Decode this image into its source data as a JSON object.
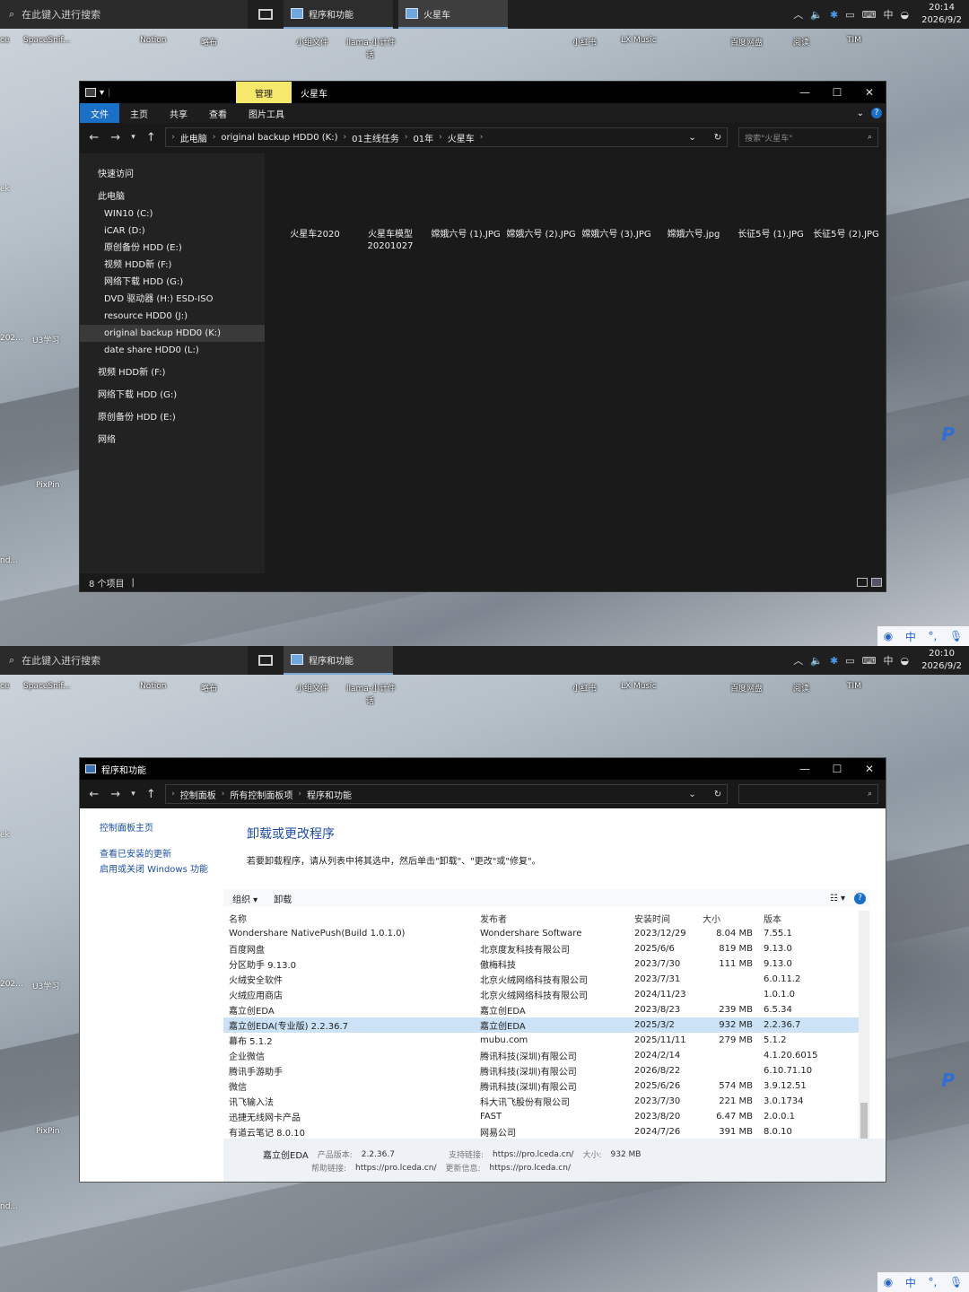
{
  "top": {
    "taskbar": {
      "search_placeholder": "在此键入进行搜索",
      "apps": [
        "程序和功能",
        "火星车"
      ],
      "time": "20:14",
      "date": "2026/9/2",
      "ime": "中"
    },
    "desktop_icons": [
      "ce",
      "SpaceSnif...",
      "Notion",
      "略布",
      "小组文件",
      "llama-小计件",
      "小红书",
      "LX Music",
      "百度网盘",
      "阅读",
      "TIM"
    ],
    "desktop_sub": "话",
    "side_labels": [
      "ek",
      "202...",
      "U3学习",
      "PixPin",
      "nd..."
    ],
    "explorer": {
      "title": "火星车",
      "manage_tab": "管理",
      "ribbon_tabs": [
        "文件",
        "主页",
        "共享",
        "查看",
        "图片工具"
      ],
      "breadcrumb": [
        "此电脑",
        "original backup HDD0 (K:)",
        "01主线任务",
        "01年",
        "火星车"
      ],
      "search_placeholder": "搜索\"火星车\"",
      "nav": {
        "quick": "快速访问",
        "pc": "此电脑",
        "drives": [
          "WIN10 (C:)",
          "iCAR (D:)",
          "原创备份 HDD (E:)",
          "视频 HDD新 (F:)",
          "网络下载 HDD (G:)",
          "DVD 驱动器 (H:) ESD-ISO",
          "resource HDD0 (J:)",
          "original backup HDD0 (K:)",
          "date share HDD0 (L:)"
        ],
        "extra": [
          "视频 HDD新 (F:)",
          "网络下载 HDD (G:)",
          "原创备份 HDD (E:)",
          "网络"
        ]
      },
      "files": [
        "火星车2020",
        "火星车模型 20201027",
        "嫦娥六号 (1).JPG",
        "嫦娥六号 (2).JPG",
        "嫦娥六号 (3).JPG",
        "嫦娥六号.jpg",
        "长征5号 (1).JPG",
        "长征5号 (2).JPG"
      ],
      "status": "8 个项目"
    }
  },
  "bottom": {
    "taskbar": {
      "search_placeholder": "在此键入进行搜索",
      "apps": [
        "程序和功能"
      ],
      "time": "20:10",
      "date": "2026/9/2",
      "ime": "中"
    },
    "window": {
      "title": "程序和功能",
      "breadcrumb": [
        "控制面板",
        "所有控制面板项",
        "程序和功能"
      ],
      "left_links": [
        "控制面板主页",
        "查看已安装的更新",
        "启用或关闭 Windows 功能"
      ],
      "heading": "卸载或更改程序",
      "description": "若要卸载程序，请从列表中将其选中，然后单击\"卸载\"、\"更改\"或\"修复\"。",
      "toolbar": [
        "组织 ▾",
        "卸载"
      ],
      "columns": [
        "名称",
        "发布者",
        "安装时间",
        "大小",
        "版本"
      ],
      "rows": [
        [
          "Wondershare NativePush(Build 1.0.1.0)",
          "Wondershare Software",
          "2023/12/29",
          "8.04 MB",
          "7.55.1"
        ],
        [
          "百度网盘",
          "北京度友科技有限公司",
          "2025/6/6",
          "819 MB",
          "9.13.0"
        ],
        [
          "分区助手 9.13.0",
          "傲梅科技",
          "2023/7/30",
          "111 MB",
          "9.13.0"
        ],
        [
          "火绒安全软件",
          "北京火绒网络科技有限公司",
          "2023/7/31",
          "",
          "6.0.11.2"
        ],
        [
          "火绒应用商店",
          "北京火绒网络科技有限公司",
          "2024/11/23",
          "",
          "1.0.1.0"
        ],
        [
          "嘉立创EDA",
          "嘉立创EDA",
          "2023/8/23",
          "239 MB",
          "6.5.34"
        ],
        [
          "嘉立创EDA(专业版) 2.2.36.7",
          "嘉立创EDA",
          "2025/3/2",
          "932 MB",
          "2.2.36.7"
        ],
        [
          "幕布 5.1.2",
          "mubu.com",
          "2025/11/11",
          "279 MB",
          "5.1.2"
        ],
        [
          "企业微信",
          "腾讯科技(深圳)有限公司",
          "2024/2/14",
          "",
          "4.1.20.6015"
        ],
        [
          "腾讯手游助手",
          "腾讯科技(深圳)有限公司",
          "2026/8/22",
          "",
          "6.10.71.10"
        ],
        [
          "微信",
          "腾讯科技(深圳)有限公司",
          "2025/6/26",
          "574 MB",
          "3.9.12.51"
        ],
        [
          "讯飞输入法",
          "科大讯飞股份有限公司",
          "2023/7/30",
          "221 MB",
          "3.0.1734"
        ],
        [
          "迅捷无线网卡产品",
          "FAST",
          "2023/8/20",
          "6.47 MB",
          "2.0.0.1"
        ],
        [
          "有道云笔记 8.0.10",
          "网易公司",
          "2024/7/26",
          "391 MB",
          "8.0.10"
        ]
      ],
      "selected_row": 6,
      "details": {
        "name": "嘉立创EDA",
        "version_label": "产品版本:",
        "version": "2.2.36.7",
        "support_label": "支持链接:",
        "support": "https://pro.lceda.cn/",
        "size_label": "大小:",
        "size": "932 MB",
        "help_label": "帮助链接:",
        "help": "https://pro.lceda.cn/",
        "update_label": "更新信息:",
        "update": "https://pro.lceda.cn/"
      }
    }
  }
}
